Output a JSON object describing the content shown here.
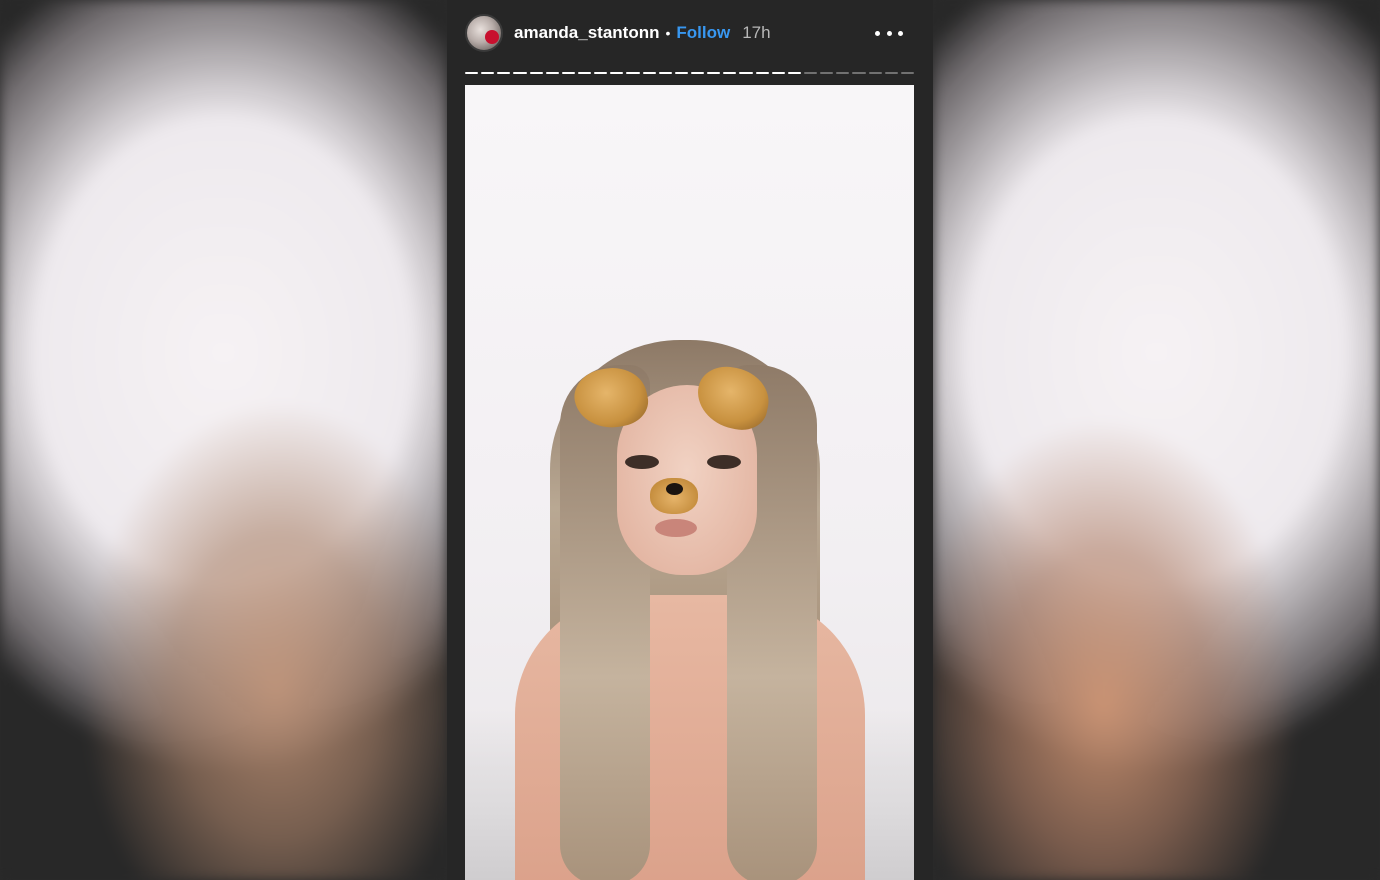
{
  "story": {
    "username": "amanda_stantonn",
    "separator": "•",
    "follow_label": "Follow",
    "time_ago": "17h"
  },
  "progress": {
    "segments_total": 28,
    "segments_viewed": 21
  },
  "icons": {
    "avatar": "profile-avatar",
    "more": "more-options-icon"
  },
  "colors": {
    "follow": "#3897f0",
    "panel_background": "#262626"
  }
}
